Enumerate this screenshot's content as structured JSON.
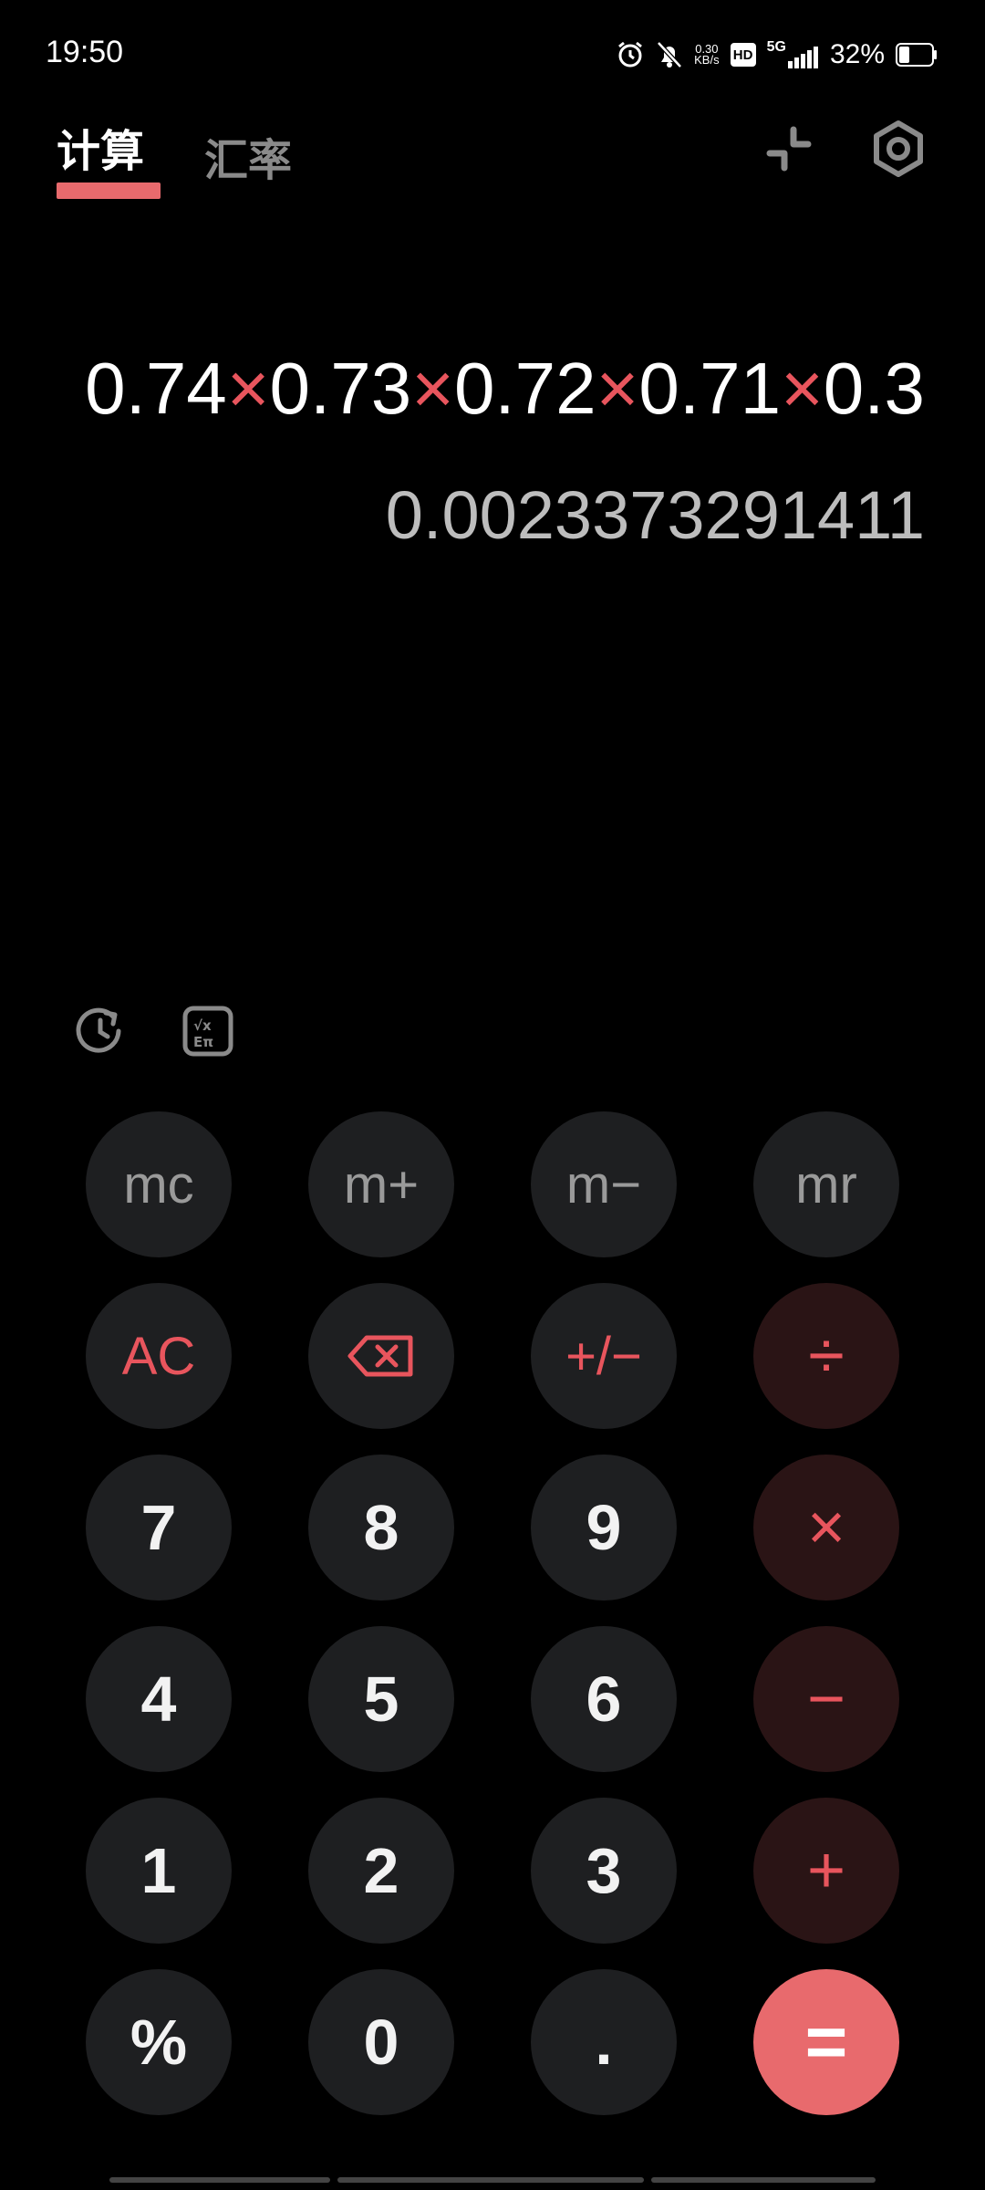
{
  "status": {
    "time": "19:50",
    "net_speed_value": "0.30",
    "net_speed_unit": "KB/s",
    "hd": "HD",
    "network": "5G",
    "battery": "32%",
    "battery_level": 0.32
  },
  "tabs": [
    {
      "label": "计算",
      "active": true
    },
    {
      "label": "汇率",
      "active": false
    }
  ],
  "display": {
    "expression_parts": [
      {
        "text": "0.74",
        "op": false
      },
      {
        "text": "×",
        "op": true
      },
      {
        "text": "0.73",
        "op": false
      },
      {
        "text": "×",
        "op": true
      },
      {
        "text": "0.72",
        "op": false
      },
      {
        "text": "×",
        "op": true
      },
      {
        "text": "0.71",
        "op": false
      },
      {
        "text": "×",
        "op": true
      },
      {
        "text": "0.3",
        "op": false
      }
    ],
    "result": "0.0023373291411"
  },
  "keys": [
    [
      {
        "label": "mc",
        "kind": "mem",
        "name": "mc-button"
      },
      {
        "label": "m+",
        "kind": "mem",
        "name": "m-plus-button"
      },
      {
        "label": "m−",
        "kind": "mem",
        "name": "m-minus-button"
      },
      {
        "label": "mr",
        "kind": "mem",
        "name": "mr-button"
      }
    ],
    [
      {
        "label": "AC",
        "kind": "func",
        "name": "ac-button"
      },
      {
        "label": "",
        "kind": "func",
        "icon": "backspace-icon",
        "name": "backspace-button"
      },
      {
        "label": "+/−",
        "kind": "func",
        "name": "sign-toggle-button"
      },
      {
        "label": "÷",
        "kind": "op",
        "name": "divide-button"
      }
    ],
    [
      {
        "label": "7",
        "kind": "num",
        "name": "digit-7-button"
      },
      {
        "label": "8",
        "kind": "num",
        "name": "digit-8-button"
      },
      {
        "label": "9",
        "kind": "num",
        "name": "digit-9-button"
      },
      {
        "label": "×",
        "kind": "op",
        "name": "multiply-button"
      }
    ],
    [
      {
        "label": "4",
        "kind": "num",
        "name": "digit-4-button"
      },
      {
        "label": "5",
        "kind": "num",
        "name": "digit-5-button"
      },
      {
        "label": "6",
        "kind": "num",
        "name": "digit-6-button"
      },
      {
        "label": "−",
        "kind": "op",
        "name": "subtract-button"
      }
    ],
    [
      {
        "label": "1",
        "kind": "num",
        "name": "digit-1-button"
      },
      {
        "label": "2",
        "kind": "num",
        "name": "digit-2-button"
      },
      {
        "label": "3",
        "kind": "num",
        "name": "digit-3-button"
      },
      {
        "label": "+",
        "kind": "op",
        "name": "add-button"
      }
    ],
    [
      {
        "label": "%",
        "kind": "num",
        "name": "percent-button"
      },
      {
        "label": "0",
        "kind": "num",
        "name": "digit-0-button"
      },
      {
        "label": ".",
        "kind": "num",
        "name": "decimal-button"
      },
      {
        "label": "=",
        "kind": "equals",
        "name": "equals-button"
      }
    ]
  ],
  "colors": {
    "accent": "#e86a6d",
    "operator": "#e8555d",
    "key_bg": "#1e1f21",
    "op_key_bg": "#2a1415"
  }
}
